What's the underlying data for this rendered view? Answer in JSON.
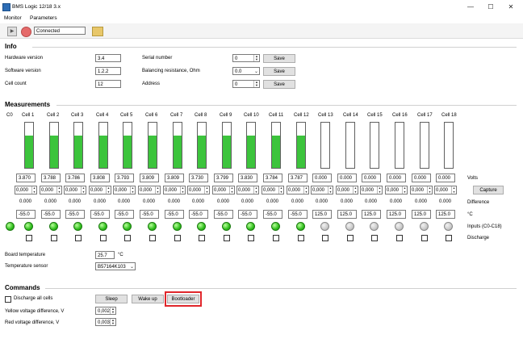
{
  "window": {
    "title": "BMS Logic 12/18 3.x",
    "minimize": "—",
    "maximize": "☐",
    "close": "✕"
  },
  "menu": [
    "Monitor",
    "Parameters"
  ],
  "toolbar": {
    "status": "Connected"
  },
  "info": {
    "title": "Info",
    "hardware_label": "Hardware version",
    "hardware_value": "3.4",
    "software_label": "Software version",
    "software_value": "1.2.2",
    "cellcount_label": "Cell count",
    "cellcount_value": "12",
    "serial_label": "Serial number",
    "serial_value": "0",
    "balance_label": "Balancing resistance, Ohm",
    "balance_value": "0.0",
    "address_label": "Address",
    "address_value": "0",
    "save_label": "Save"
  },
  "measurements": {
    "title": "Measurements",
    "c0_label": "C0",
    "cells": [
      {
        "name": "Cell 1",
        "level": 0.72,
        "volts": "3.870",
        "diff": "0,000",
        "diff_text": "0.000",
        "temp": "-55.0",
        "led": "on"
      },
      {
        "name": "Cell 2",
        "level": 0.72,
        "volts": "3.788",
        "diff": "0,000",
        "diff_text": "0.000",
        "temp": "-55.0",
        "led": "on"
      },
      {
        "name": "Cell 3",
        "level": 0.72,
        "volts": "3.786",
        "diff": "0,000",
        "diff_text": "0.000",
        "temp": "-55.0",
        "led": "on"
      },
      {
        "name": "Cell 4",
        "level": 0.72,
        "volts": "3.808",
        "diff": "0,000",
        "diff_text": "0.000",
        "temp": "-55.0",
        "led": "on"
      },
      {
        "name": "Cell 5",
        "level": 0.72,
        "volts": "3.793",
        "diff": "0,000",
        "diff_text": "0.000",
        "temp": "-55.0",
        "led": "on"
      },
      {
        "name": "Cell 6",
        "level": 0.72,
        "volts": "3.809",
        "diff": "0,000",
        "diff_text": "0.000",
        "temp": "-55.0",
        "led": "on"
      },
      {
        "name": "Cell 7",
        "level": 0.72,
        "volts": "3.809",
        "diff": "0,000",
        "diff_text": "0.000",
        "temp": "-55.0",
        "led": "on"
      },
      {
        "name": "Cell 8",
        "level": 0.72,
        "volts": "3.730",
        "diff": "0,000",
        "diff_text": "0.000",
        "temp": "-55.0",
        "led": "on"
      },
      {
        "name": "Cell 9",
        "level": 0.72,
        "volts": "3.799",
        "diff": "0,000",
        "diff_text": "0.000",
        "temp": "-55.0",
        "led": "on"
      },
      {
        "name": "Cell 10",
        "level": 0.72,
        "volts": "3.830",
        "diff": "0,000",
        "diff_text": "0.000",
        "temp": "-55.0",
        "led": "on"
      },
      {
        "name": "Cell 11",
        "level": 0.72,
        "volts": "3.784",
        "diff": "0,000",
        "diff_text": "0.000",
        "temp": "-55.0",
        "led": "on"
      },
      {
        "name": "Cell 12",
        "level": 0.72,
        "volts": "3.787",
        "diff": "0,000",
        "diff_text": "0.000",
        "temp": "-55.0",
        "led": "on"
      },
      {
        "name": "Cell 13",
        "level": 0,
        "volts": "0.000",
        "diff": "0,000",
        "diff_text": "0.000",
        "temp": "125.0",
        "led": "off"
      },
      {
        "name": "Cell 14",
        "level": 0,
        "volts": "0.000",
        "diff": "0,000",
        "diff_text": "0.000",
        "temp": "125.0",
        "led": "off"
      },
      {
        "name": "Cell 15",
        "level": 0,
        "volts": "0.000",
        "diff": "0,000",
        "diff_text": "0.000",
        "temp": "125.0",
        "led": "off"
      },
      {
        "name": "Cell 16",
        "level": 0,
        "volts": "0.000",
        "diff": "0,000",
        "diff_text": "0.000",
        "temp": "125.0",
        "led": "off"
      },
      {
        "name": "Cell 17",
        "level": 0,
        "volts": "0.000",
        "diff": "0,000",
        "diff_text": "0.000",
        "temp": "125.0",
        "led": "off"
      },
      {
        "name": "Cell 18",
        "level": 0,
        "volts": "0.000",
        "diff": "0,000",
        "diff_text": "0.000",
        "temp": "125.0",
        "led": "off"
      }
    ],
    "row_labels": {
      "volts": "Volts",
      "capture": "Capture",
      "difference": "Difference",
      "celsius": "°C",
      "inputs": "Inputs (C0-C18)",
      "discharge": "Discharge"
    },
    "board_temp_label": "Board temperature",
    "board_temp_value": "25.7",
    "board_temp_unit": "°C",
    "sensor_label": "Temperature sensor",
    "sensor_value": "B57164K103"
  },
  "commands": {
    "title": "Commands",
    "discharge_all_label": "Discharge all cells",
    "sleep_label": "Sleep",
    "wakeup_label": "Wake up",
    "bootloader_label": "Bootloader",
    "yellow_label": "Yellow voltage difference, V",
    "yellow_value": "0,002",
    "red_label": "Red voltage difference, V",
    "red_value": "0,003"
  },
  "colors": {
    "cell_fill": "#3cc43c",
    "highlight": "#e0262b"
  }
}
